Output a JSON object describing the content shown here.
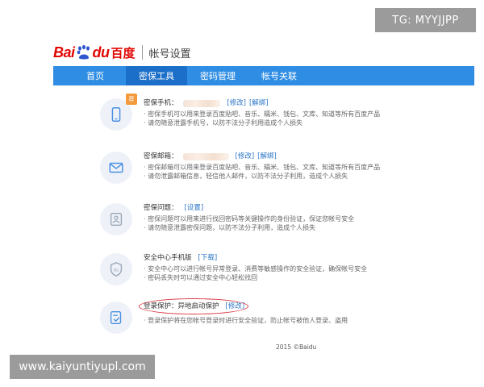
{
  "overlay": {
    "tg_label": "TG: MYYJJPP",
    "watermark": "www.kaiyuntiyupl.com"
  },
  "header": {
    "logo_bai": "Bai",
    "logo_du": "du",
    "logo_cn": "百度",
    "title": "帐号设置"
  },
  "nav": {
    "items": [
      {
        "label": "首页",
        "active": false
      },
      {
        "label": "密保工具",
        "active": true
      },
      {
        "label": "密码管理",
        "active": false
      },
      {
        "label": "帐号关联",
        "active": false
      }
    ]
  },
  "colors": {
    "nav_bg": "#2f8de4",
    "nav_active": "#1c6fc9",
    "link": "#2a76c6",
    "highlight_circle": "#d9363e",
    "badge": "#f39a3c"
  },
  "rows": [
    {
      "icon": "phone-icon",
      "badge": "荐",
      "label": "密保手机：",
      "masked": {
        "visible": true,
        "width_pct": 78
      },
      "links": [
        "[修改]",
        "[解绑]"
      ],
      "desc": [
        "· 密保手机可以用来登录百度贴吧、音乐、糯米、钱包、文库、知道等所有百度产品",
        "· 请勿随意泄露手机号，以防不法分子利用造成个人损失"
      ]
    },
    {
      "icon": "mail-icon",
      "label": "密保邮箱：",
      "masked": {
        "visible": true,
        "width_pct": 95
      },
      "links": [
        "[修改]",
        "[解绑]"
      ],
      "desc": [
        "· 密保邮箱可以用来登录百度贴吧、音乐、糯米、钱包、文库、知道等所有百度产品",
        "· 请勿泄露邮箱信息，轻信他人邮件，以防不法分子利用，造成个人损失"
      ]
    },
    {
      "icon": "question-icon",
      "label": "密保问题：",
      "masked": {
        "visible": false,
        "width_pct": 0
      },
      "links": [
        "[设置]"
      ],
      "desc": [
        "· 密保问题可以用来进行找回密码等关键操作的身份验证，保证您帐号安全",
        "· 请勿随意泄露密保问题，以防不法分子利用，造成个人损失"
      ]
    },
    {
      "icon": "shield-du-icon",
      "label": "安全中心手机版",
      "masked": {
        "visible": false,
        "width_pct": 0
      },
      "links": [
        "[下载]"
      ],
      "desc": [
        "· 安全中心可以进行帐号异常登录、消费等敏感操作的安全验证，确保帐号安全",
        "· 密码丢失时可以通过安全中心轻松找回"
      ]
    },
    {
      "icon": "login-check-icon",
      "label": "登录保护：异地启动保护",
      "highlighted": true,
      "masked": {
        "visible": false,
        "width_pct": 0
      },
      "links": [
        "[修改]"
      ],
      "desc": [
        "· 登录保护将在您帐号登录时进行安全验证，防止帐号被他人登录、盗用"
      ]
    }
  ],
  "footer": {
    "copyright": "2015 ©Baidu"
  }
}
